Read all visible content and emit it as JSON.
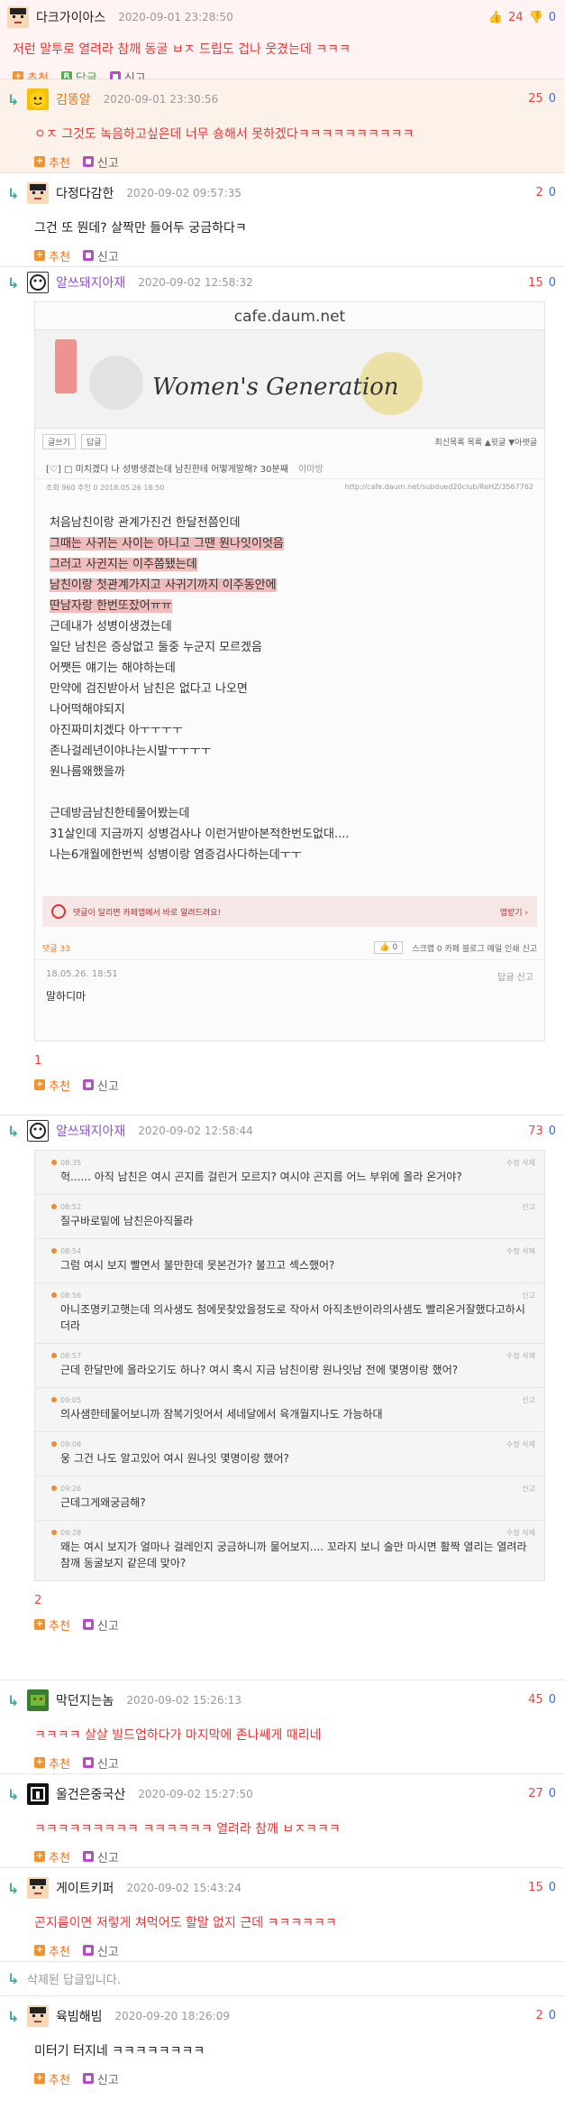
{
  "comments": [
    {
      "nick": "다크가이아스",
      "time": "2020-09-01 23:28:50",
      "up": "24",
      "down": "0",
      "text": "저런 말투로 열려라 참깨 동굴 ㅂㅈ 드립도 겁나 웃겼는데 ㅋㅋㅋ",
      "recommend": "추천",
      "reply": "답글",
      "report": "신고"
    },
    {
      "nick": "김똥알",
      "time": "2020-09-01 23:30:56",
      "up": "25",
      "down": "0",
      "text": "ㅇㅈ 그것도 녹음하고싶은데 너무 숑해서 못하겠다ㅋㅋㅋㅋㅋㅋㅋㅋㅋㅋ",
      "recommend": "추천",
      "report": "신고"
    },
    {
      "nick": "다정다감한",
      "time": "2020-09-02 09:57:35",
      "up": "2",
      "down": "0",
      "text": "그건 또 뭔데? 살짝만 들어두 궁금하다ㅋ",
      "recommend": "추천",
      "report": "신고"
    },
    {
      "nick": "알쓰돼지아재",
      "time": "2020-09-02 12:58:32",
      "up": "15",
      "down": "0",
      "count": "1",
      "recommend": "추천",
      "report": "신고"
    },
    {
      "nick": "알쓰돼지아재",
      "time": "2020-09-02 12:58:44",
      "up": "73",
      "down": "0",
      "count": "2",
      "recommend": "추천",
      "report": "신고"
    },
    {
      "nick": "막던지는놈",
      "time": "2020-09-02 15:26:13",
      "up": "45",
      "down": "0",
      "text": "ㅋㅋㅋㅋ 살살 빌드업하다가 마지막에 존나쎄게 때리네",
      "recommend": "추천",
      "report": "신고"
    },
    {
      "nick": "울건은중국산",
      "time": "2020-09-02 15:27:50",
      "up": "27",
      "down": "0",
      "text": "ㅋㅋㅋㅋㅋㅋㅋㅋㅋ ㅋㅋㅋㅋㅋㅋ 열려라 참깨 ㅂㅈㅋㅋㅋ",
      "recommend": "추천",
      "report": "신고"
    },
    {
      "nick": "게이트키퍼",
      "time": "2020-09-02 15:43:24",
      "up": "15",
      "down": "0",
      "text": "곤지름이면 저렇게 쳐먹어도 할말 없지 근데 ㅋㅋㅋㅋㅋㅋ",
      "recommend": "추천",
      "report": "신고"
    },
    {
      "nick": "육빔해빔",
      "time": "2020-09-20 18:26:09",
      "up": "2",
      "down": "0",
      "text": "미터기 터지네 ㅋㅋㅋㅋㅋㅋㅋㅋ",
      "recommend": "추천",
      "report": "신고"
    }
  ],
  "deleted_reply": "삭제된 답글입니다.",
  "embed1": {
    "url": "cafe.daum.net",
    "banner_title": "Women's Generation",
    "btn_write": "글쓰기",
    "btn_reply": "답글",
    "nav": "최신목록  목록  ▲윗글  ▼아랫글",
    "title": "[♡] □ 미치겠다 나 성병생겼는데 남친한테 어떻게말해? 30분째",
    "title_author": "야마방",
    "meta": "조회 960  추천 0  2018.05.26 18:50",
    "meta_url": "http://cafe.daum.net/subdued20club/ReHZ/3567762",
    "lines": [
      "처음남친이랑 관계가진건 한달전쯤인데",
      "그때는 사귀는 사이는 아니고 그땐 원나잇이엇음",
      "그러고 사귄지는 이주쯤됐는데",
      "남친이랑 첫관계가지고 사귀기까지 이주동안에",
      "딴남자랑 한번또잤어ㅠㅠ",
      "근데내가 성병이생겼는데",
      "일단 남친은 증상없고 둘중 누군지 모르겠음",
      "어쨋든 얘기는 해야하는데",
      "만약에 검진받아서 남친은 없다고 나오면",
      "나어떡해야되지",
      "아진짜미치겠다 아ㅜㅜㅜㅜ",
      "존나걸레년이야나는시발ㅜㅜㅜㅜ",
      "원나름왜했을까",
      "",
      "근데방금남친한테물어봤는데",
      "31살인데 지금까지 성병검사나 이런거받아본적한번도없대....",
      "나는6개월에한번씩 성병이랑 염증검사다하는데ㅜㅜ"
    ],
    "notice": "댓글이 달리면 카페앱에서 바로 알려드려요!",
    "notice_link": "앱받기 ›",
    "reply_count": "댓글 33",
    "like": "0",
    "share_items": "스크랩 0   카페   블로그   메일   인쇄   신고",
    "inner_meta": "18.05.26. 18:51",
    "inner_actions": "답글  신고",
    "inner_text": "말하디마"
  },
  "thread2": {
    "items": [
      {
        "meta": "08:35",
        "right": "수정  삭제",
        "text": "헉...... 아직 남친은 여시 곤지름 걸린거 모르지? 여시야 곤지름 어느 부위에 올라 온거야?"
      },
      {
        "meta": "08:52",
        "right": "신고",
        "text": "질구바로밑에 남친은아직몰라"
      },
      {
        "meta": "08:54",
        "right": "수정  삭제",
        "text": "그럼 여시 보지 빨면서 불만한데 못본건가? 불끄고 섹스했어?"
      },
      {
        "meta": "08:56",
        "right": "신고",
        "text": "아니조명키고햇는데 의사생도 첨에못찾았을정도로 작아서 아직초반이라의사샘도 빨리온거잘했다고하시더라"
      },
      {
        "meta": "08:57",
        "right": "수정  삭제",
        "text": "근데 한달만에 올라오기도 하나? 여시 혹시 지금 남친이랑 원나잇남 전에 몇명이랑 했어?"
      },
      {
        "meta": "09:05",
        "right": "신고",
        "text": "의사샘한테물어보니까 잠복기잇어서 세네달에서 육개월지나도 가능하대"
      },
      {
        "meta": "09:08",
        "right": "수정  삭제",
        "text": "웅 그건 나도 알고있어 여시 원나잇 몇명이랑 했어?"
      },
      {
        "meta": "09:26",
        "right": "신고",
        "text": "근데그게왜궁금해?"
      },
      {
        "meta": "09:28",
        "right": "수정  삭제",
        "text": "왜는 여시 보지가 얼마나 걸레인지 궁금하니까 물어보지.... 꼬라지 보니 술만 마시면 활짝 열리는 열려라 참깨 동굴보지 같은데 맞아?"
      }
    ]
  },
  "colors": {
    "accent_orange": "#ff6a00",
    "up_red": "#e64545",
    "down_blue": "#3a6bd6",
    "best_bg": "#fff3f3"
  }
}
